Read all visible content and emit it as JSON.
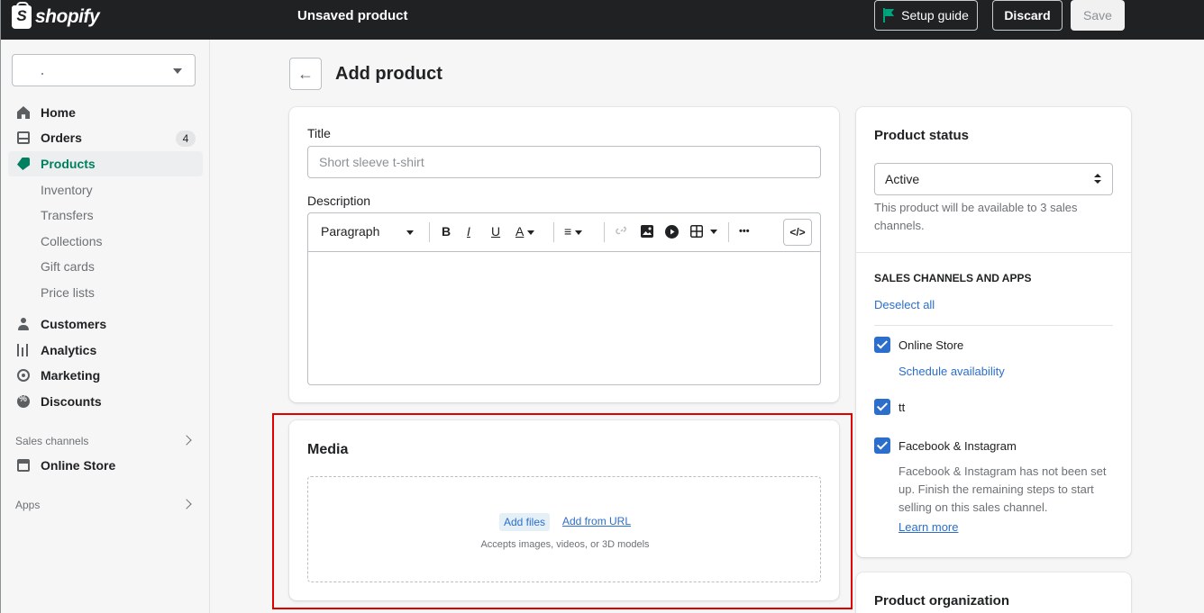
{
  "app": {
    "logo_text": "shopify",
    "logo_glyph": "S"
  },
  "topbar": {
    "title": "Unsaved product",
    "setup_label": "Setup guide",
    "discard_label": "Discard",
    "save_label": "Save"
  },
  "sidebar": {
    "store_value": "",
    "nav": [
      {
        "label": "Home",
        "icon": "home-icon"
      },
      {
        "label": "Orders",
        "icon": "orders-icon",
        "badge": "4"
      },
      {
        "label": "Products",
        "icon": "tag-icon",
        "active": true
      },
      {
        "label": "Customers",
        "icon": "customer-icon"
      },
      {
        "label": "Analytics",
        "icon": "analytics-icon"
      },
      {
        "label": "Marketing",
        "icon": "marketing-icon"
      },
      {
        "label": "Discounts",
        "icon": "discount-icon"
      }
    ],
    "sub_items": [
      "Inventory",
      "Transfers",
      "Collections",
      "Gift cards",
      "Price lists"
    ],
    "sales_channels_label": "Sales channels",
    "online_store_label": "Online Store",
    "apps_label": "Apps"
  },
  "main": {
    "page_title": "Add product",
    "title_label": "Title",
    "title_placeholder": "Short sleeve t-shirt",
    "description_label": "Description",
    "toolbar": {
      "paragraph": "Paragraph",
      "bold": "B",
      "italic": "I",
      "underline": "U",
      "color": "A",
      "align": "≡",
      "more": "•••",
      "code": "</>"
    },
    "media": {
      "title": "Media",
      "add_files": "Add files",
      "add_from_url": "Add from URL",
      "accepts": "Accepts images, videos, or 3D models"
    }
  },
  "right": {
    "status_title": "Product status",
    "status_value": "Active",
    "status_help": "This product will be available to 3 sales channels.",
    "channels_title": "SALES CHANNELS AND APPS",
    "deselect_all": "Deselect all",
    "channels": [
      {
        "label": "Online Store",
        "checked": true,
        "link": "Schedule availability"
      },
      {
        "label": "tt",
        "checked": true
      },
      {
        "label": "Facebook & Instagram",
        "checked": true,
        "note": "Facebook & Instagram has not been set up. Finish the remaining steps to start selling on this sales channel.",
        "link": "Learn more"
      }
    ],
    "organization_title": "Product organization"
  },
  "colors": {
    "accent": "#008060",
    "link": "#2c6ecb",
    "topbar": "#202123",
    "highlight": "#e00000"
  }
}
